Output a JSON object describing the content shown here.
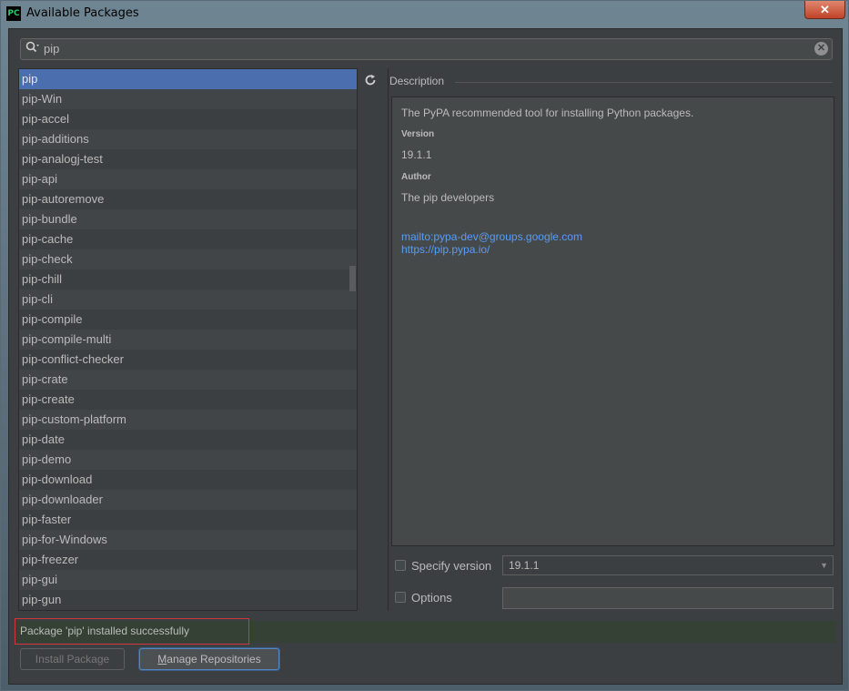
{
  "window": {
    "title": "Available Packages",
    "app_icon": "PC",
    "close_label": "✕"
  },
  "search": {
    "value": "pip",
    "icon": "search-icon",
    "clear_icon": "clear-icon"
  },
  "packages": [
    "pip",
    "pip-Win",
    "pip-accel",
    "pip-additions",
    "pip-analogj-test",
    "pip-api",
    "pip-autoremove",
    "pip-bundle",
    "pip-cache",
    "pip-check",
    "pip-chill",
    "pip-cli",
    "pip-compile",
    "pip-compile-multi",
    "pip-conflict-checker",
    "pip-crate",
    "pip-create",
    "pip-custom-platform",
    "pip-date",
    "pip-demo",
    "pip-download",
    "pip-downloader",
    "pip-faster",
    "pip-for-Windows",
    "pip-freezer",
    "pip-gui",
    "pip-gun"
  ],
  "selected_package": "pip",
  "description": {
    "header": "Description",
    "summary": "The PyPA recommended tool for installing Python packages.",
    "version_label": "Version",
    "version": "19.1.1",
    "author_label": "Author",
    "author": "The pip developers",
    "email_link": "mailto:pypa-dev@groups.google.com",
    "home_link": "https://pip.pypa.io/"
  },
  "options": {
    "specify_version_label": "Specify version",
    "specify_version_checked": false,
    "version_value": "19.1.1",
    "options_label": "Options",
    "options_checked": false,
    "options_value": ""
  },
  "status": {
    "message": "Package 'pip' installed successfully"
  },
  "buttons": {
    "install": "Install Package",
    "manage": "Manage Repositories"
  },
  "colors": {
    "selection": "#4b6eaf",
    "link": "#589df6",
    "status_bg": "#344134",
    "highlight_border": "#d0373a"
  }
}
